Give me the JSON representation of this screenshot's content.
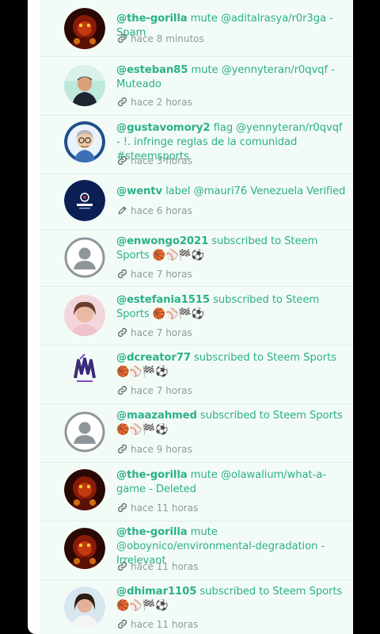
{
  "feed": {
    "items": [
      {
        "user": "@the-gorilla",
        "text": " mute @aditalrasya/r0r3ga - Spam",
        "time": "hace 8 minutos",
        "icon": "link-icon",
        "avatar": "gorilla"
      },
      {
        "user": "@esteban85",
        "text": " mute @yennyteran/r0qvqf - Muteado",
        "time": "hace 2 horas",
        "icon": "link-icon",
        "avatar": "photo-man"
      },
      {
        "user": "@gustavomory2",
        "text": " flag @yennyteran/r0qvqf - !. infringe reglas de la comunidad #steemsports",
        "time": "hace 3 horas",
        "icon": "link-icon",
        "avatar": "cartoon"
      },
      {
        "user": "@wentv",
        "text": " label @mauri76 Venezuela Verified",
        "time": "hace 6 horas",
        "icon": "pencil-icon",
        "avatar": "wentv"
      },
      {
        "user": "@enwongo2021",
        "text": " subscribed to Steem Sports 🏀⚾🏁⚽",
        "time": "hace 7 horas",
        "icon": "link-icon",
        "avatar": "default"
      },
      {
        "user": "@estefania1515",
        "text": " subscribed to Steem Sports 🏀⚾🏁⚽",
        "time": "hace 7 horas",
        "icon": "link-icon",
        "avatar": "photo-woman"
      },
      {
        "user": "@dcreator77",
        "text": " subscribed to Steem Sports 🏀⚾🏁⚽",
        "time": "hace 7 horas",
        "icon": "link-icon",
        "avatar": "logo"
      },
      {
        "user": "@maazahmed",
        "text": " subscribed to Steem Sports 🏀⚾🏁⚽",
        "time": "hace 9 horas",
        "icon": "link-icon",
        "avatar": "default"
      },
      {
        "user": "@the-gorilla",
        "text": " mute @olawalium/what-a-game - Deleted",
        "time": "hace 11 horas",
        "icon": "link-icon",
        "avatar": "gorilla"
      },
      {
        "user": "@the-gorilla",
        "text": " mute @oboynico/environmental-degradation - Irrelevant",
        "time": "hace 11 horas",
        "icon": "link-icon",
        "avatar": "gorilla"
      },
      {
        "user": "@dhimar1105",
        "text": " subscribed to Steem Sports 🏀⚾🏁⚽",
        "time": "hace 11 horas",
        "icon": "link-icon",
        "avatar": "photo-woman2"
      }
    ]
  }
}
